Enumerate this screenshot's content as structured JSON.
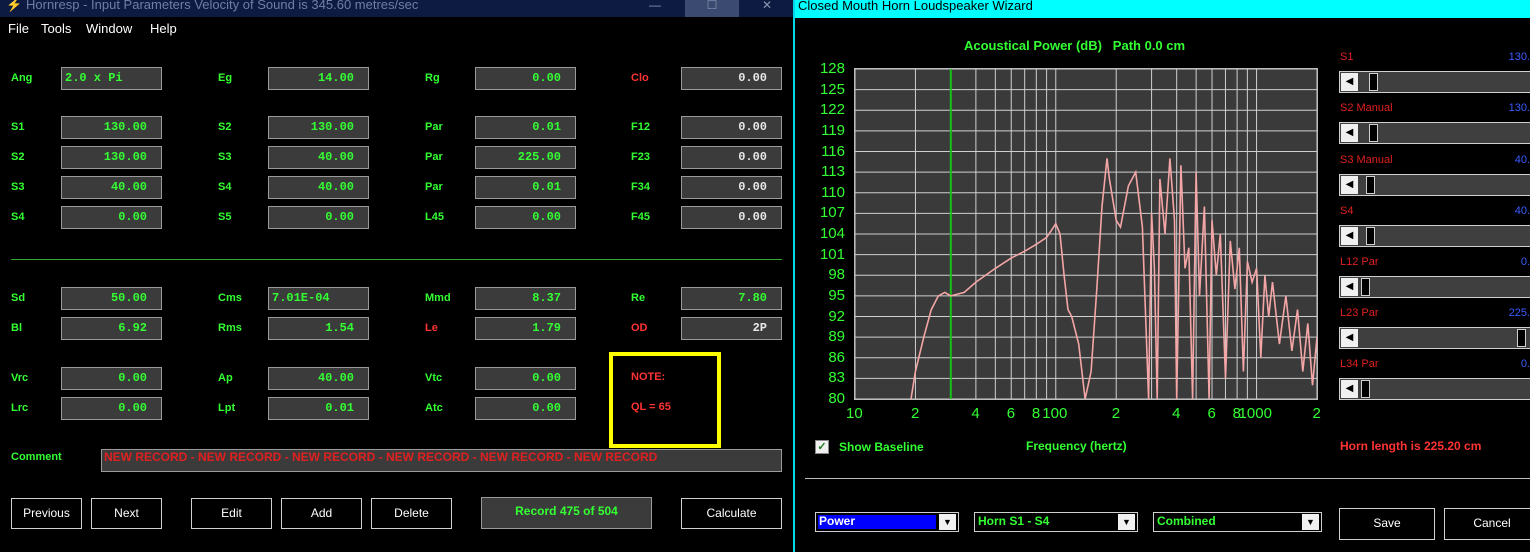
{
  "left_window": {
    "title": "Hornresp - Input Parameters   Velocity of Sound is 345.60 metres/sec",
    "menu": [
      "File",
      "Tools",
      "Window",
      "Help"
    ],
    "fields_top": [
      {
        "label": "Ang",
        "value": "2.0 x Pi",
        "label_color": "green"
      },
      {
        "label": "Eg",
        "value": "14.00",
        "label_color": "green"
      },
      {
        "label": "Rg",
        "value": "0.00",
        "label_color": "green"
      },
      {
        "label": "Clo",
        "value": "0.00",
        "label_color": "red"
      },
      {
        "label": "S1",
        "value": "130.00",
        "label_color": "green"
      },
      {
        "label": "S2",
        "value": "130.00",
        "label_color": "green"
      },
      {
        "label": "Par",
        "value": "0.01",
        "label_color": "green"
      },
      {
        "label": "F12",
        "value": "0.00",
        "label_color": "green"
      },
      {
        "label": "S2",
        "value": "130.00",
        "label_color": "green"
      },
      {
        "label": "S3",
        "value": "40.00",
        "label_color": "green"
      },
      {
        "label": "Par",
        "value": "225.00",
        "label_color": "green"
      },
      {
        "label": "F23",
        "value": "0.00",
        "label_color": "green"
      },
      {
        "label": "S3",
        "value": "40.00",
        "label_color": "green"
      },
      {
        "label": "S4",
        "value": "40.00",
        "label_color": "green"
      },
      {
        "label": "Par",
        "value": "0.01",
        "label_color": "green"
      },
      {
        "label": "F34",
        "value": "0.00",
        "label_color": "green"
      },
      {
        "label": "S4",
        "value": "0.00",
        "label_color": "green"
      },
      {
        "label": "S5",
        "value": "0.00",
        "label_color": "green"
      },
      {
        "label": "L45",
        "value": "0.00",
        "label_color": "green"
      },
      {
        "label": "F45",
        "value": "0.00",
        "label_color": "green"
      }
    ],
    "fields_driver": [
      {
        "label": "Sd",
        "value": "50.00",
        "label_color": "green"
      },
      {
        "label": "Cms",
        "value": "7.01E-04",
        "label_color": "green"
      },
      {
        "label": "Mmd",
        "value": "8.37",
        "label_color": "green"
      },
      {
        "label": "Re",
        "value": "7.80",
        "label_color": "green"
      },
      {
        "label": "Bl",
        "value": "6.92",
        "label_color": "green"
      },
      {
        "label": "Rms",
        "value": "1.54",
        "label_color": "green"
      },
      {
        "label": "Le",
        "value": "1.79",
        "label_color": "red"
      },
      {
        "label": "OD",
        "value": "2P",
        "label_color": "red"
      }
    ],
    "fields_chamber": [
      {
        "label": "Vrc",
        "value": "0.00",
        "label_color": "green"
      },
      {
        "label": "Ap",
        "value": "40.00",
        "label_color": "green"
      },
      {
        "label": "Vtc",
        "value": "0.00",
        "label_color": "green"
      },
      {
        "label": "Lrc",
        "value": "0.00",
        "label_color": "green"
      },
      {
        "label": "Lpt",
        "value": "0.01",
        "label_color": "green"
      },
      {
        "label": "Atc",
        "value": "0.00",
        "label_color": "green"
      }
    ],
    "note": {
      "title": "NOTE:",
      "text": "QL = 65"
    },
    "comment_label": "Comment",
    "comment_value": "NEW RECORD - NEW RECORD - NEW RECORD - NEW RECORD - NEW RECORD - NEW RECORD",
    "buttons": {
      "previous": "Previous",
      "next": "Next",
      "edit": "Edit",
      "add": "Add",
      "delete": "Delete",
      "calculate": "Calculate"
    },
    "record_status": "Record 475 of 504"
  },
  "right_window": {
    "title": "Closed Mouth Horn Loudspeaker Wizard",
    "show_baseline_label": "Show Baseline",
    "show_baseline_checked": true,
    "horn_length": "Horn length is 225.20 cm",
    "sliders": [
      {
        "label": "S1",
        "value": "130.",
        "label_color": "#e02020",
        "value_color": "#3b5bff",
        "position": 0.05
      },
      {
        "label": "S2 Manual",
        "value": "130.",
        "label_color": "#e02020",
        "value_color": "#3b5bff",
        "position": 0.05
      },
      {
        "label": "S3 Manual",
        "value": "40.",
        "label_color": "#e02020",
        "value_color": "#3b5bff",
        "position": 0.03
      },
      {
        "label": "S4",
        "value": "40.",
        "label_color": "#e02020",
        "value_color": "#3b5bff",
        "position": 0.03
      },
      {
        "label": "L12 Par",
        "value": "0.",
        "label_color": "#e02020",
        "value_color": "#3b5bff",
        "position": 0.0
      },
      {
        "label": "L23 Par",
        "value": "225.",
        "label_color": "#e02020",
        "value_color": "#3b5bff",
        "position": 0.99
      },
      {
        "label": "L34 Par",
        "value": "0.",
        "label_color": "#e02020",
        "value_color": "#3b5bff",
        "position": 0.0
      }
    ],
    "combos": [
      {
        "value": "Power",
        "selected_bg": "#0000ff",
        "text_color": "#ffffff"
      },
      {
        "value": "Horn S1 - S4",
        "selected_bg": "#000000",
        "text_color": "#33ff33"
      },
      {
        "value": "Combined",
        "selected_bg": "#000000",
        "text_color": "#33ff33"
      }
    ],
    "save_label": "Save",
    "cancel_label": "Cancel"
  },
  "chart_data": {
    "type": "line",
    "title": "Acoustical Power (dB)   Path 0.0 cm",
    "xlabel": "Frequency (hertz)",
    "ylabel": "",
    "x_scale": "log",
    "xlim": [
      10,
      2000
    ],
    "ylim": [
      80,
      128
    ],
    "yticks": [
      128,
      125,
      122,
      119,
      116,
      113,
      110,
      107,
      104,
      101,
      98,
      95,
      92,
      89,
      86,
      83,
      80
    ],
    "xtick_labels": [
      "10",
      "2",
      "4",
      "6",
      "8",
      "100",
      "2",
      "4",
      "6",
      "8",
      "1000",
      "2"
    ],
    "xtick_values": [
      10,
      20,
      40,
      60,
      80,
      100,
      200,
      400,
      600,
      800,
      1000,
      2000
    ],
    "grid": true,
    "baseline_marker_x": 30,
    "series": [
      {
        "color": "#f4a6a6",
        "x": [
          19,
          20,
          22,
          24,
          26,
          28,
          30,
          35,
          40,
          50,
          60,
          70,
          80,
          90,
          95,
          100,
          105,
          110,
          115,
          120,
          130,
          140,
          150,
          160,
          170,
          180,
          185,
          190,
          200,
          210,
          230,
          250,
          270,
          290,
          300,
          310,
          320,
          330,
          350,
          370,
          390,
          400,
          420,
          440,
          460,
          480,
          500,
          520,
          550,
          580,
          600,
          630,
          660,
          700,
          740,
          780,
          820,
          860,
          900,
          950,
          1000,
          1050,
          1100,
          1150,
          1200,
          1300,
          1400,
          1500,
          1600,
          1700,
          1800,
          1900,
          2000
        ],
        "y": [
          80,
          84,
          89,
          93,
          95,
          95.5,
          95,
          95.5,
          97,
          99,
          100.5,
          101.5,
          102.5,
          103.5,
          104.5,
          105.5,
          104,
          98,
          93,
          92,
          88,
          80,
          84,
          96,
          108,
          115,
          112,
          110,
          106,
          105,
          111,
          113,
          105,
          80,
          107,
          99,
          80,
          112,
          104,
          115,
          106,
          80,
          114,
          99,
          102,
          80,
          113,
          95,
          108,
          80,
          106,
          98,
          104,
          83,
          103,
          96,
          102,
          84,
          100,
          97,
          99,
          86,
          98,
          92,
          97,
          88,
          95,
          87,
          93,
          84,
          91,
          82,
          89
        ]
      }
    ]
  }
}
